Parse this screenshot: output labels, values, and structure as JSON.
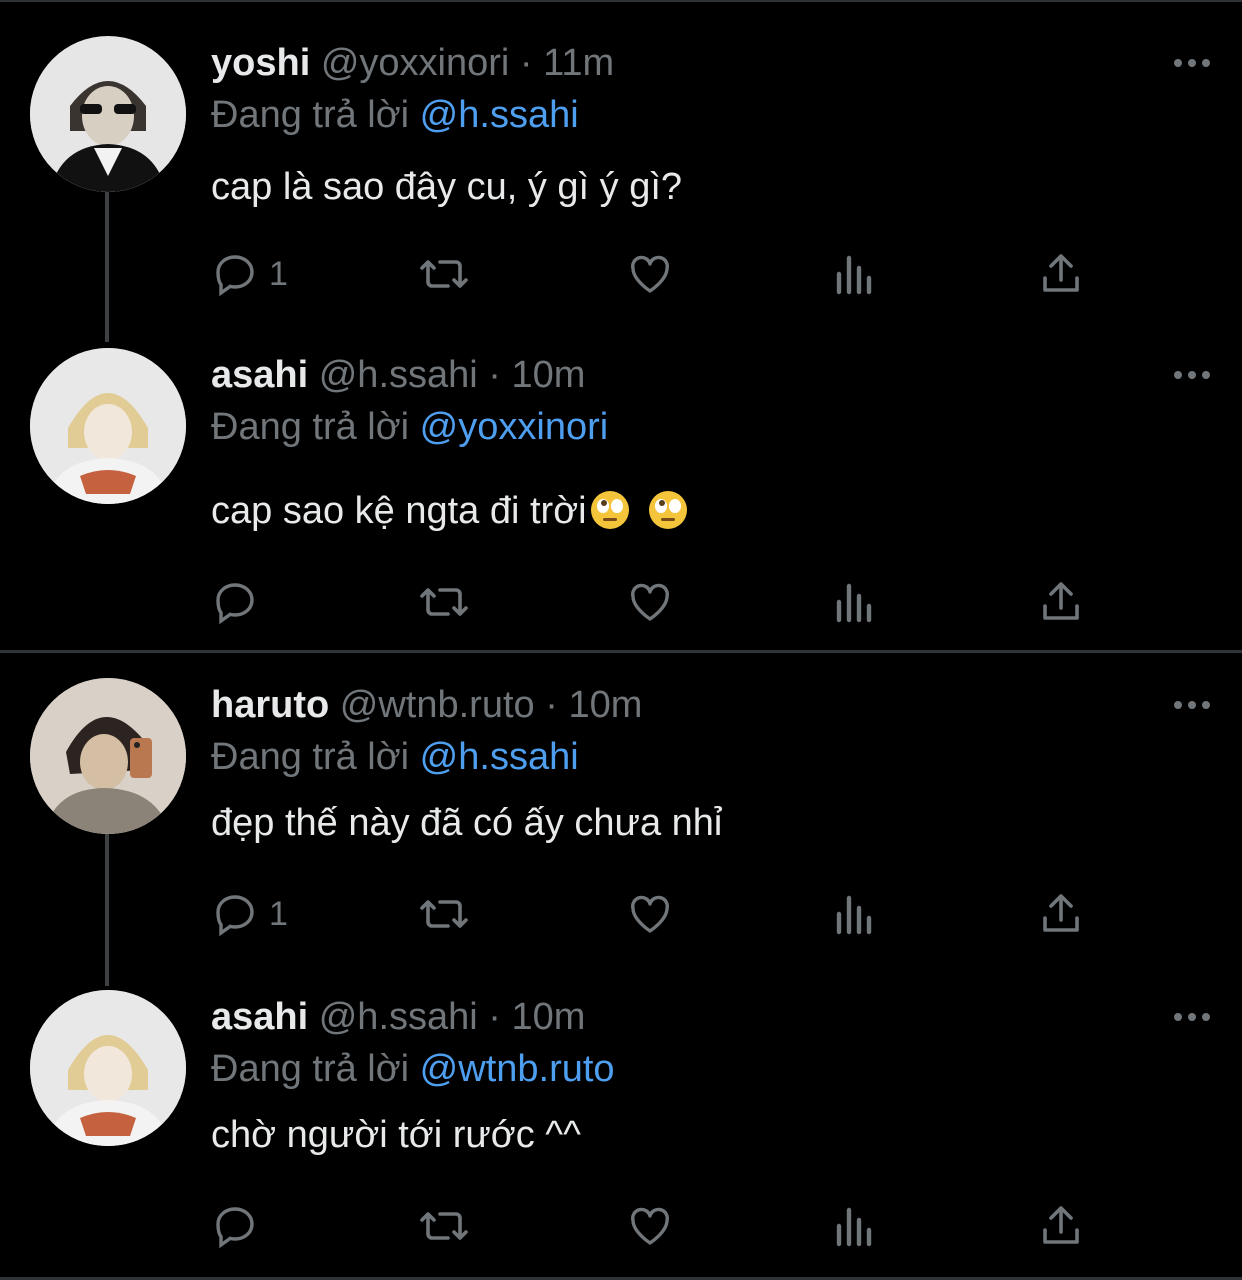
{
  "colors": {
    "background": "#000000",
    "text": "#e7e9ea",
    "muted": "#71767b",
    "mention": "#4f9ff0",
    "divider": "#2f3336"
  },
  "threads": [
    {
      "tweets": [
        {
          "name": "yoshi",
          "handle": "@yoxxinori",
          "sep": "·",
          "time": "11m",
          "reply_prefix": "Đang trả lời",
          "reply_to": "@h.ssahi",
          "text": "cap là sao đây cu, ý gì ý gì?",
          "emoji": [],
          "reply_count": "1",
          "avatar": "yoshi-avatar"
        },
        {
          "name": "asahi",
          "handle": "@h.ssahi",
          "sep": "·",
          "time": "10m",
          "reply_prefix": "Đang trả lời",
          "reply_to": "@yoxxinori",
          "text": "cap sao kệ ngta đi trời",
          "emoji": [
            "face-with-rolling-eyes",
            "face-with-rolling-eyes"
          ],
          "reply_count": "",
          "avatar": "asahi-avatar"
        }
      ]
    },
    {
      "tweets": [
        {
          "name": "haruto",
          "handle": "@wtnb.ruto",
          "sep": "·",
          "time": "10m",
          "reply_prefix": "Đang trả lời",
          "reply_to": "@h.ssahi",
          "text": "đẹp thế này đã có ấy chưa nhỉ",
          "emoji": [],
          "reply_count": "1",
          "avatar": "haruto-avatar"
        },
        {
          "name": "asahi",
          "handle": "@h.ssahi",
          "sep": "·",
          "time": "10m",
          "reply_prefix": "Đang trả lời",
          "reply_to": "@wtnb.ruto",
          "text": "chờ người tới rước ^^",
          "emoji": [],
          "reply_count": "",
          "avatar": "asahi-avatar"
        }
      ]
    }
  ],
  "icons": [
    "reply-icon",
    "retweet-icon",
    "like-icon",
    "views-icon",
    "share-icon",
    "more-icon"
  ]
}
